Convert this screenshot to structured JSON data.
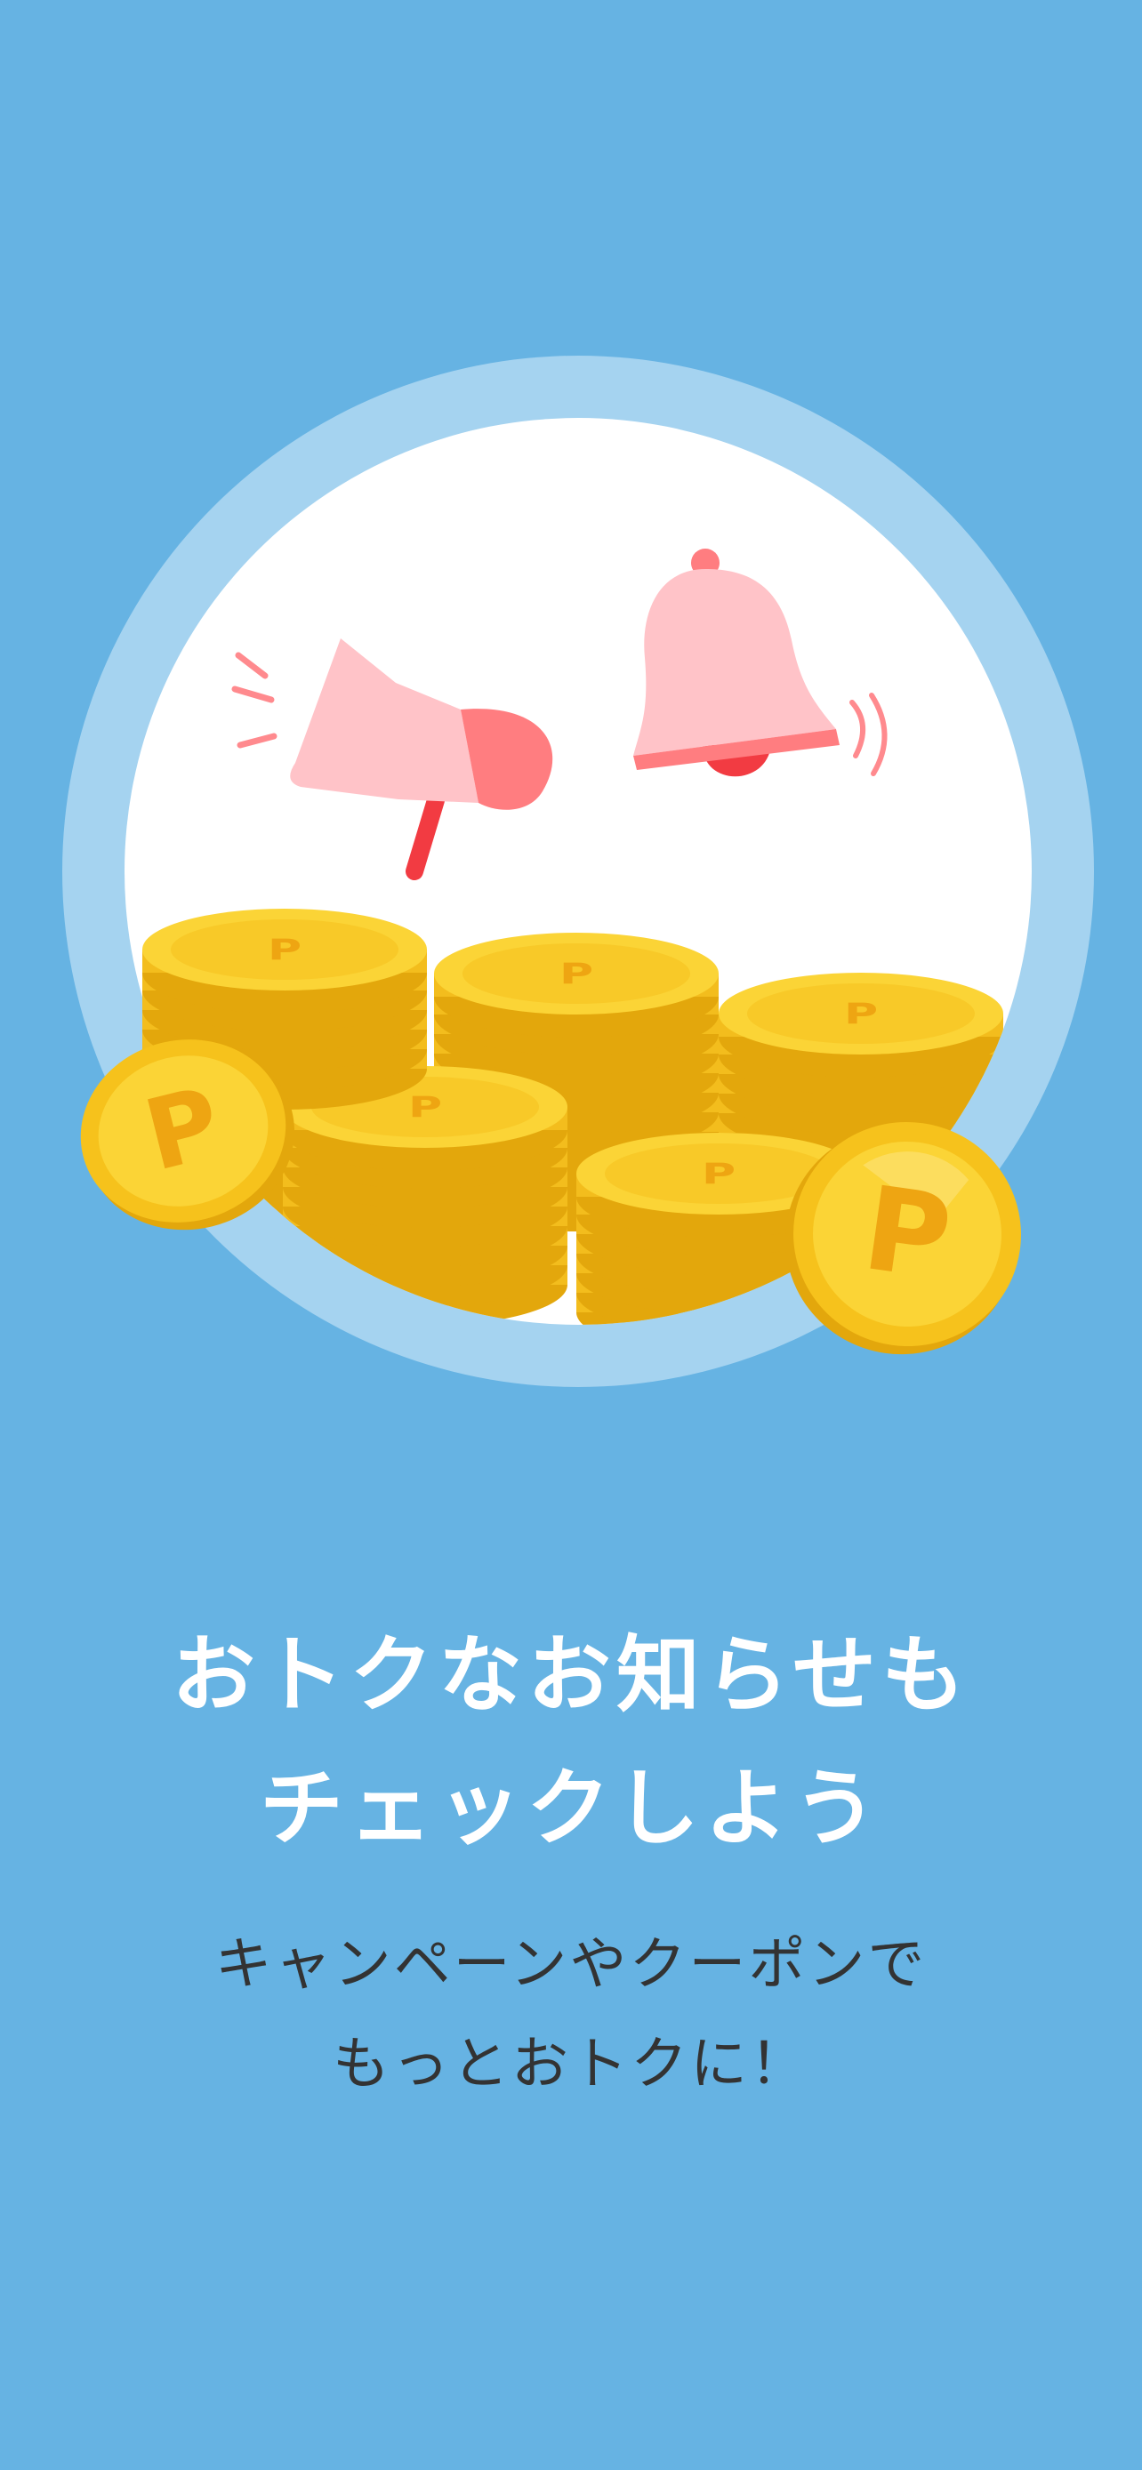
{
  "onboarding": {
    "headline_line1": "おトクなお知らせも",
    "headline_line2": "チェックしよう",
    "subtext_line1": "キャンペーンやクーポンで",
    "subtext_line2": "もっとおトクに！"
  },
  "illustration": {
    "icons": [
      "megaphone-icon",
      "bell-icon",
      "point-coin-icon"
    ],
    "coin_glyph": "P"
  },
  "colors": {
    "background": "#66b3e3",
    "ring": "#a5d3f0",
    "circle": "#ffffff",
    "headline": "#ffffff",
    "subtext": "#333333",
    "megaphone_light": "#ffc3c8",
    "megaphone_dark": "#ff7d80",
    "accent_red": "#f23b42",
    "coin_gold": "#f6c21c",
    "coin_edge": "#e3a70c"
  }
}
